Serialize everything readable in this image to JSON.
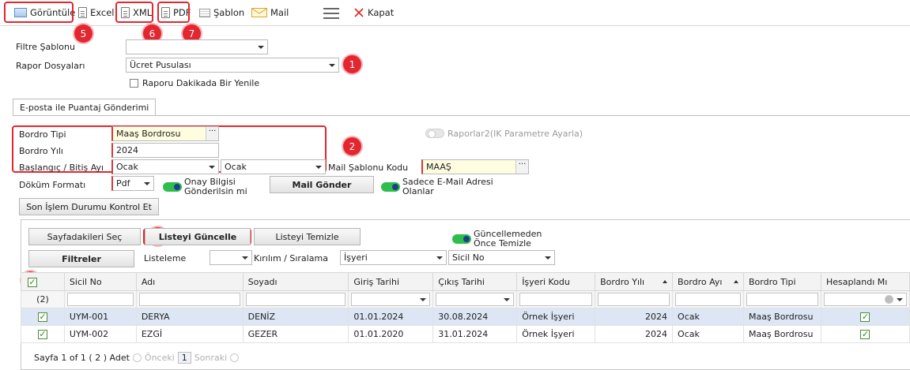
{
  "toolbar": {
    "goruntule": "Görüntüle",
    "excel": "Excel",
    "xml": "XML",
    "pdf": "PDF",
    "sablon": "Şablon",
    "mail": "Mail",
    "kapat": "Kapat"
  },
  "badges": [
    "1",
    "2",
    "3",
    "4",
    "5",
    "6",
    "7"
  ],
  "filter": {
    "filtre_sablonu_label": "Filtre Şablonu",
    "filtre_sablonu_value": "",
    "rapor_dosyalari_label": "Rapor Dosyaları",
    "rapor_dosyalari_value": "Ücret Pusulası",
    "dakika_yenile_label": "Raporu Dakikada Bir Yenile"
  },
  "tab": {
    "label": "E-posta ile Puantaj Gönderimi"
  },
  "form": {
    "bordro_tipi_label": "Bordro Tipi",
    "bordro_tipi_value": "Maaş Bordrosu",
    "bordro_yili_label": "Bordro Yılı",
    "bordro_yili_value": "2024",
    "baslangic_bitis_label": "Başlangıç / Bitiş Ayı",
    "baslangic_value": "Ocak",
    "bitis_value": "Ocak",
    "dokum_formati_label": "Döküm Formatı",
    "dokum_formati_value": "Pdf",
    "onay_bilgisi_label": "Onay Bilgisi Gönderilsin mi",
    "mail_gonder": "Mail Gönder",
    "sadece_email_label": "Sadece E-Mail Adresi Olanlar",
    "raporlar2_label": "Raporlar2(IK Parametre Ayarla)",
    "mail_sablonu_label": "Mail Şablonu Kodu",
    "mail_sablonu_value": "MAAŞ",
    "son_islem_button": "Son İşlem Durumu Kontrol Et"
  },
  "gridtools": {
    "sayfadakileri_sec": "Sayfadakileri Seç",
    "listeyi_guncelle": "Listeyi Güncelle",
    "listeyi_temizle": "Listeyi Temizle",
    "guncellemeden_label": "Güncellemeden Önce Temizle",
    "filtreler": "Filtreler",
    "listeleme_label": "Listeleme",
    "listeleme_value": "",
    "kirilim_label": "Kırılım / Sıralama",
    "kirilim_value": "İşyeri",
    "siralama_value": "Sicil No"
  },
  "grid": {
    "columns": [
      "Sicil No",
      "Adı",
      "Soyadı",
      "Giriş Tarihi",
      "Çıkış Tarihi",
      "İşyeri Kodu",
      "Bordro Yılı",
      "Bordro Ayı",
      "Bordro Tipi",
      "Hesaplandı Mı"
    ],
    "count": "(2)",
    "rows": [
      {
        "sicil": "UYM-001",
        "adi": "DERYA",
        "soyadi": "DENİZ",
        "giris": "01.01.2024",
        "cikis": "30.08.2024",
        "isyeri": "Örnek İşyeri",
        "yil": "2024",
        "ay": "Ocak",
        "tip": "Maaş Bordrosu"
      },
      {
        "sicil": "UYM-002",
        "adi": "EZGİ",
        "soyadi": "GEZER",
        "giris": "01.01.2020",
        "cikis": "31.01.2024",
        "isyeri": "Örnek İşyeri",
        "yil": "2024",
        "ay": "Ocak",
        "tip": "Maaş Bordrosu"
      }
    ]
  },
  "pager": {
    "info": "Sayfa 1 of 1 ( 2 ) Adet",
    "prev": "Önceki",
    "page": "1",
    "next": "Sonraki"
  },
  "colors": {
    "accent_red": "#e3262f",
    "toggle_green": "#2ebd4e",
    "selected_row": "#dde6f4"
  }
}
